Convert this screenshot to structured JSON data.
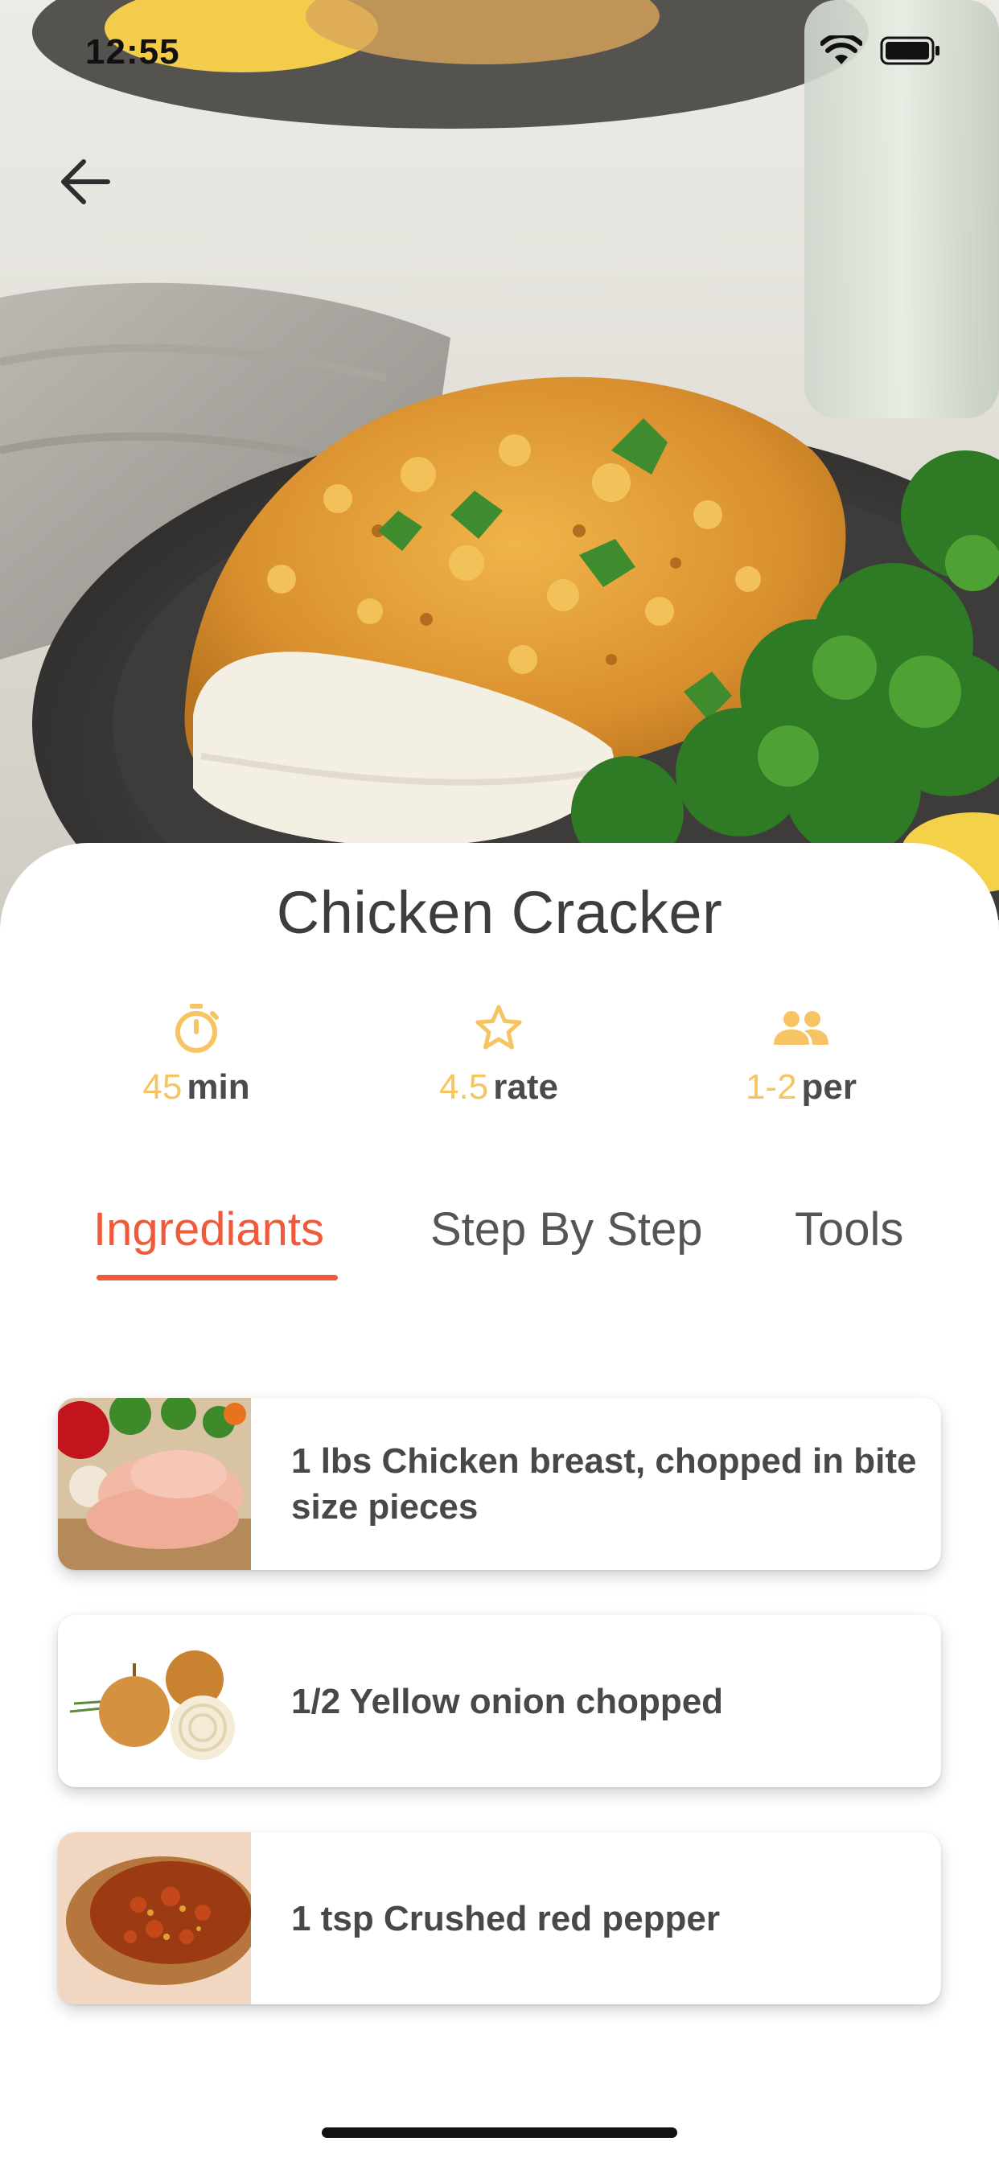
{
  "status_bar": {
    "time": "12:55"
  },
  "recipe": {
    "title": "Chicken Cracker",
    "stats": [
      {
        "icon": "stopwatch-icon",
        "value": "45",
        "unit": "min"
      },
      {
        "icon": "star-outline-icon",
        "value": "4.5",
        "unit": "rate"
      },
      {
        "icon": "people-icon",
        "value": "1-2",
        "unit": "per"
      }
    ]
  },
  "tabs": [
    {
      "label": "Ingrediants",
      "active": true
    },
    {
      "label": "Step By Step",
      "active": false
    },
    {
      "label": "Tools",
      "active": false
    }
  ],
  "ingredients": [
    {
      "text": "1 lbs Chicken breast, chopped in bite size pieces",
      "thumb": "chicken-breast-image"
    },
    {
      "text": "1/2 Yellow onion chopped",
      "thumb": "onion-image"
    },
    {
      "text": "1 tsp Crushed red pepper",
      "thumb": "red-pepper-flakes-image"
    }
  ],
  "colors": {
    "accent": "#f05a3a",
    "stat_value": "#f6c462",
    "text": "#484848"
  }
}
